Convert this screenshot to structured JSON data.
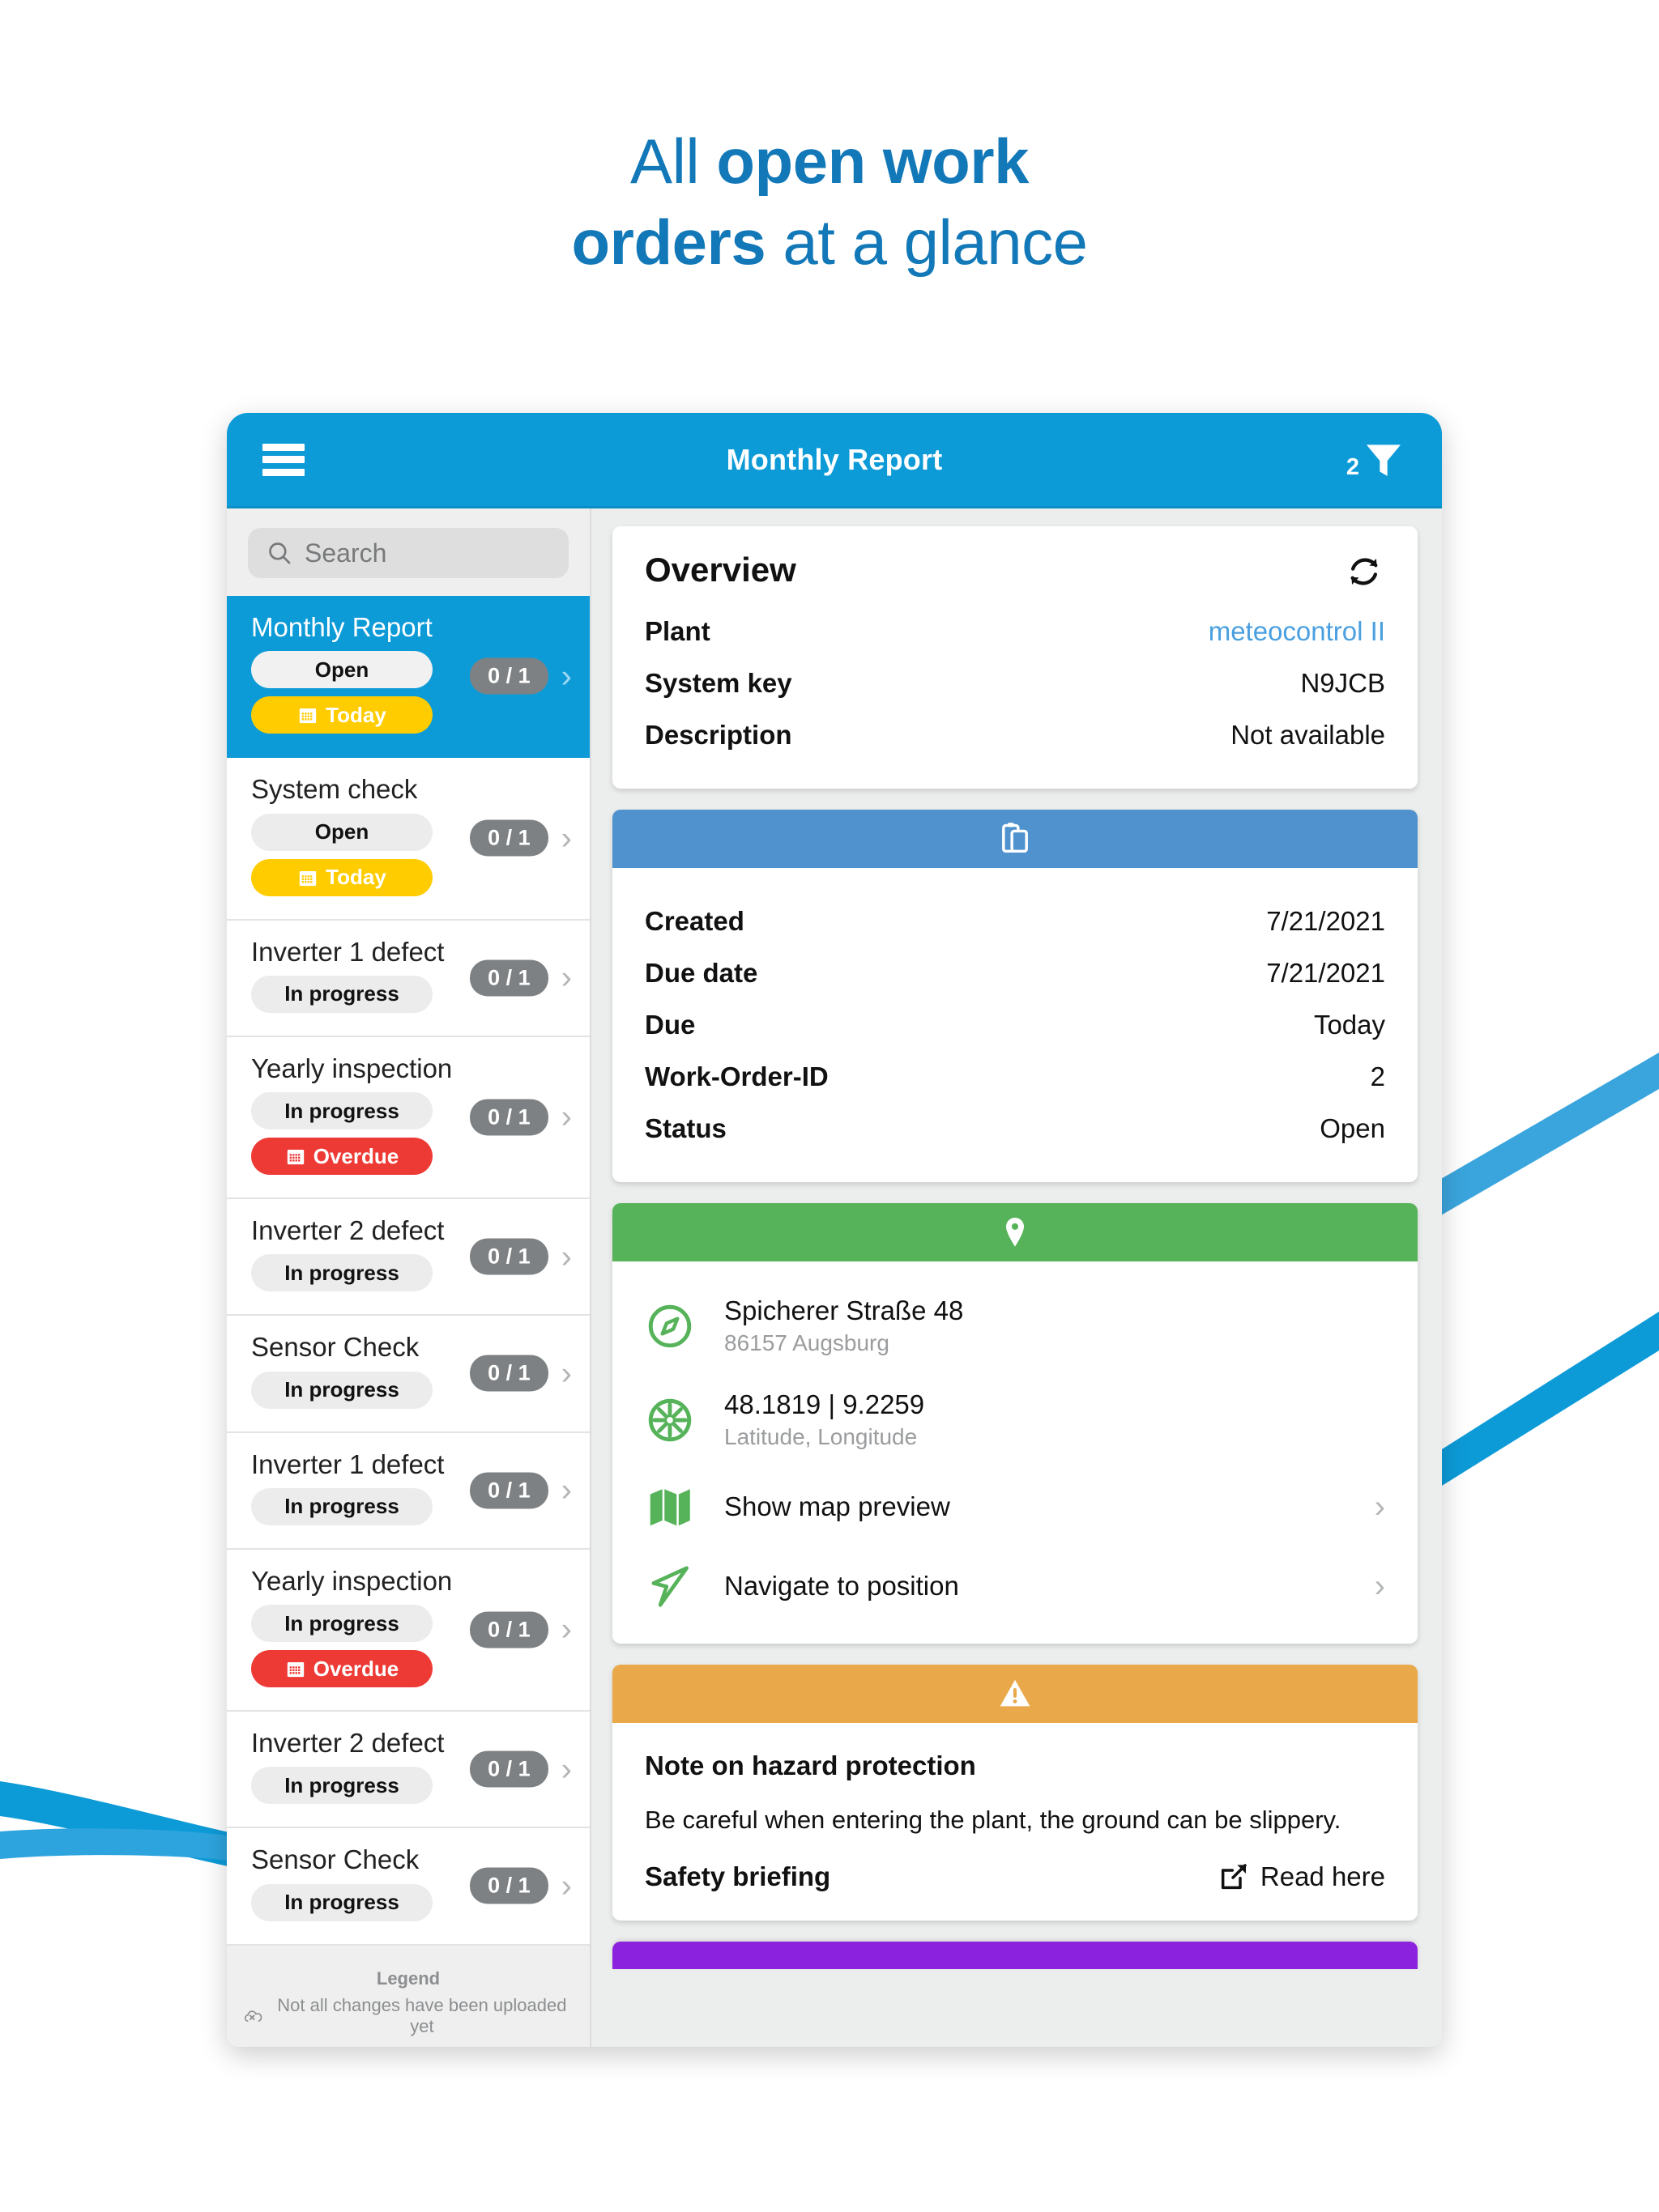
{
  "headline": {
    "line1_plain": "All ",
    "line1_bold": "open work",
    "line2_bold": "orders",
    "line2_plain": " at a glance"
  },
  "colors": {
    "brand_blue": "#0d9bd8",
    "headline_blue": "#1278b8",
    "card_blue": "#4f92cd",
    "card_green": "#56b35a",
    "card_orange": "#e9a849",
    "card_purple": "#8b22dd",
    "pill_yellow": "#ffcc00",
    "pill_red": "#ee3a35",
    "badge_gray": "#7e8183",
    "link_blue": "#4a9fe0"
  },
  "appbar": {
    "title": "Monthly Report",
    "menu_icon": "hamburger-icon",
    "filter_icon": "filter-funnel-icon",
    "filter_count": "2"
  },
  "sidebar": {
    "search": {
      "placeholder": "Search",
      "value": "",
      "icon": "search-icon"
    },
    "items": [
      {
        "title": "Monthly Report",
        "status": "Open",
        "date_tag": "Today",
        "date_type": "today",
        "count": "0 / 1",
        "selected": true
      },
      {
        "title": "System check",
        "status": "Open",
        "date_tag": "Today",
        "date_type": "today",
        "count": "0 / 1",
        "selected": false
      },
      {
        "title": "Inverter 1 defect",
        "status": "In progress",
        "date_tag": "",
        "date_type": "",
        "count": "0 / 1",
        "selected": false
      },
      {
        "title": "Yearly inspection",
        "status": "In progress",
        "date_tag": "Overdue",
        "date_type": "overdue",
        "count": "0 / 1",
        "selected": false
      },
      {
        "title": "Inverter 2 defect",
        "status": "In progress",
        "date_tag": "",
        "date_type": "",
        "count": "0 / 1",
        "selected": false
      },
      {
        "title": "Sensor Check",
        "status": "In progress",
        "date_tag": "",
        "date_type": "",
        "count": "0 / 1",
        "selected": false
      },
      {
        "title": "Inverter 1 defect",
        "status": "In progress",
        "date_tag": "",
        "date_type": "",
        "count": "0 / 1",
        "selected": false
      },
      {
        "title": "Yearly inspection",
        "status": "In progress",
        "date_tag": "Overdue",
        "date_type": "overdue",
        "count": "0 / 1",
        "selected": false
      },
      {
        "title": "Inverter 2 defect",
        "status": "In progress",
        "date_tag": "",
        "date_type": "",
        "count": "0 / 1",
        "selected": false
      },
      {
        "title": "Sensor Check",
        "status": "In progress",
        "date_tag": "",
        "date_type": "",
        "count": "0 / 1",
        "selected": false
      }
    ],
    "legend": {
      "title": "Legend",
      "entry": "Not all changes have been uploaded yet",
      "icon": "cloud-off-icon"
    }
  },
  "overview_card": {
    "title": "Overview",
    "refresh_icon": "refresh-icon",
    "rows": [
      {
        "label": "Plant",
        "value": "meteocontrol II",
        "is_link": true
      },
      {
        "label": "System key",
        "value": "N9JCB",
        "is_link": false
      },
      {
        "label": "Description",
        "value": "Not available",
        "is_link": false
      }
    ]
  },
  "workorder_card": {
    "header_icon": "clipboard-icon",
    "rows": [
      {
        "label": "Created",
        "value": "7/21/2021"
      },
      {
        "label": "Due date",
        "value": "7/21/2021"
      },
      {
        "label": "Due",
        "value": "Today"
      },
      {
        "label": "Work-Order-ID",
        "value": "2"
      },
      {
        "label": "Status",
        "value": "Open"
      }
    ]
  },
  "location_card": {
    "header_icon": "map-pin-icon",
    "address": {
      "icon": "compass-icon",
      "primary": "Spicherer Straße 48",
      "secondary": "86157 Augsburg"
    },
    "coords": {
      "icon": "crosshair-icon",
      "primary": "48.1819 | 9.2259",
      "secondary": "Latitude, Longitude"
    },
    "actions": [
      {
        "icon": "map-icon",
        "label": "Show map preview"
      },
      {
        "icon": "navigation-icon",
        "label": "Navigate to position"
      }
    ]
  },
  "hazard_card": {
    "header_icon": "warning-triangle-icon",
    "title": "Note on hazard protection",
    "text": "Be careful when entering the plant, the ground can be slippery.",
    "footer_label": "Safety briefing",
    "link_label": "Read here",
    "link_icon": "external-link-icon"
  }
}
